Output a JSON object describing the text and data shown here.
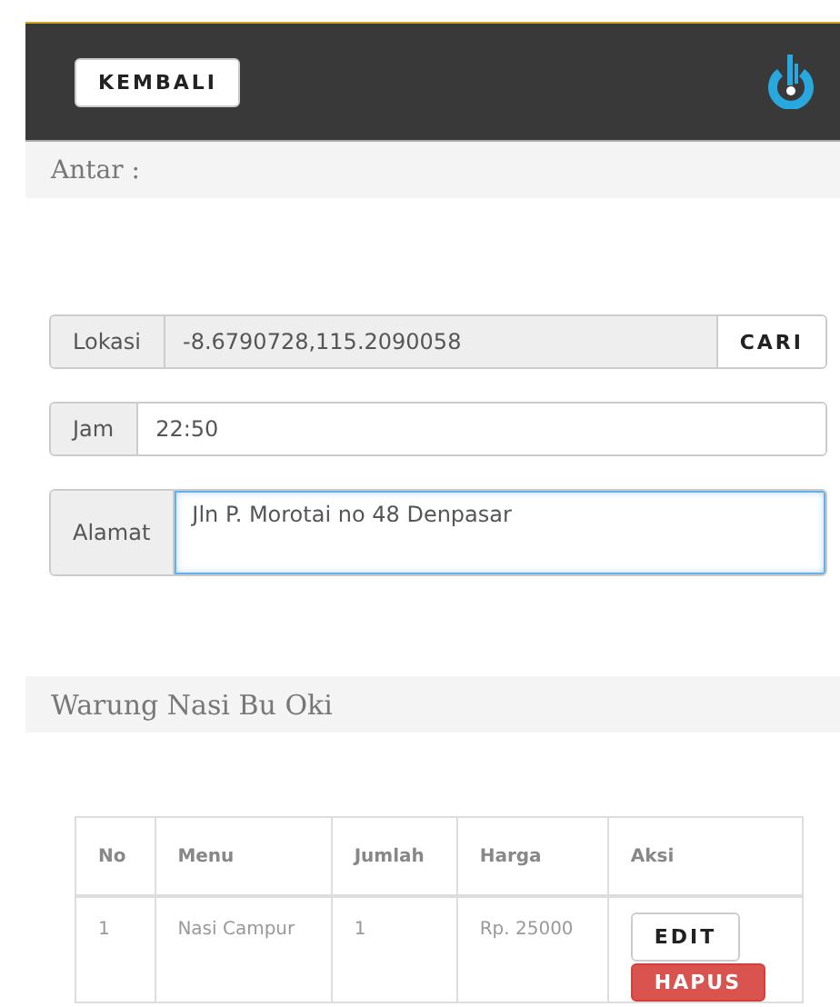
{
  "header": {
    "back_button": "KEMBALI"
  },
  "delivery_section": {
    "title": "Antar :"
  },
  "form": {
    "location": {
      "label": "Lokasi",
      "value": "-8.6790728,115.2090058",
      "button": "CARI"
    },
    "time": {
      "label": "Jam",
      "value": "22:50"
    },
    "address": {
      "label": "Alamat",
      "value": "Jln P. Morotai no 48 Denpasar",
      "focused": true
    }
  },
  "shop_section": {
    "title": "Warung Nasi Bu Oki"
  },
  "table": {
    "columns": [
      "No",
      "Menu",
      "Jumlah",
      "Harga",
      "Aksi"
    ],
    "rows": [
      {
        "no": "1",
        "menu": "Nasi Campur",
        "qty": "1",
        "price": "Rp. 25000",
        "actions": [
          "EDIT",
          "HAPUS"
        ]
      }
    ]
  }
}
